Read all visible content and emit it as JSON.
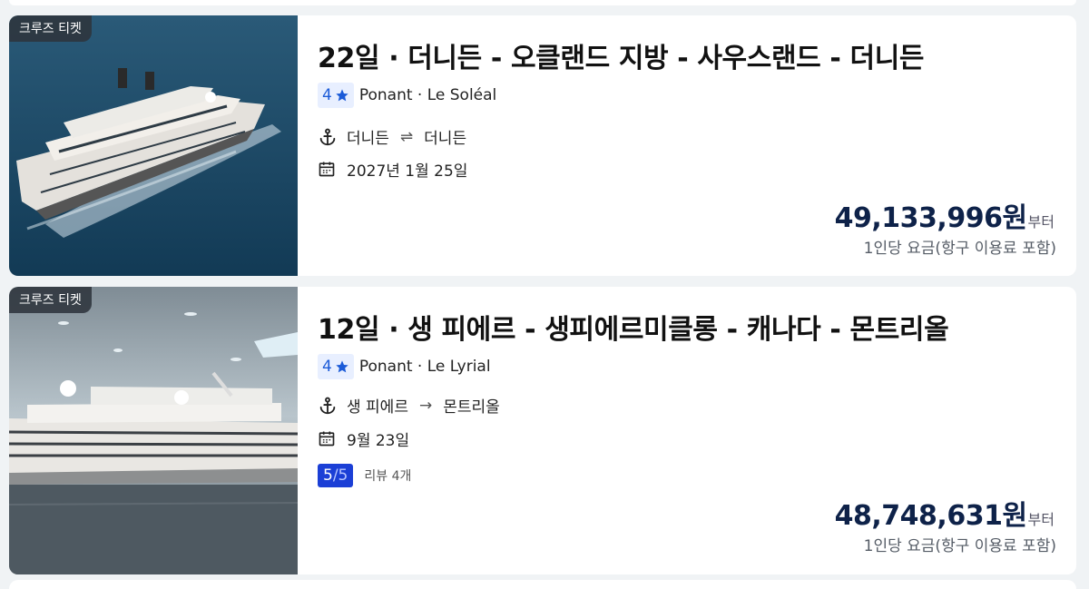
{
  "listings": [
    {
      "badge": "크루즈 티켓",
      "title": "22일 · 더니든 - 오클랜드 지방 - 사우스랜드 - 더니든",
      "rating": "4",
      "ship": "Ponant · Le Soléal",
      "route_from": "더니든",
      "route_arrow": "⇌",
      "route_to": "더니든",
      "date": "2027년 1월 25일",
      "price": "49,133,996원",
      "price_suffix": "부터",
      "price_note": "1인당 요금(항구 이용료 포함)"
    },
    {
      "badge": "크루즈 티켓",
      "title": "12일 · 생 피에르 - 생피에르미클롱 - 캐나다 - 몬트리올",
      "rating": "4",
      "ship": "Ponant · Le Lyrial",
      "route_from": "생 피에르",
      "route_arrow": "→",
      "route_to": "몬트리올",
      "date": "9월 23일",
      "review_score": "5",
      "review_total": "/5",
      "review_text": "리뷰 4개",
      "price": "48,748,631원",
      "price_suffix": "부터",
      "price_note": "1인당 요금(항구 이용료 포함)"
    }
  ],
  "icons": {
    "star": "star-icon",
    "anchor": "anchor-icon",
    "calendar": "calendar-icon"
  },
  "colors": {
    "accent_blue": "#1b5bd8",
    "score_blue": "#1b3fd6",
    "price_navy": "#0e2249"
  }
}
